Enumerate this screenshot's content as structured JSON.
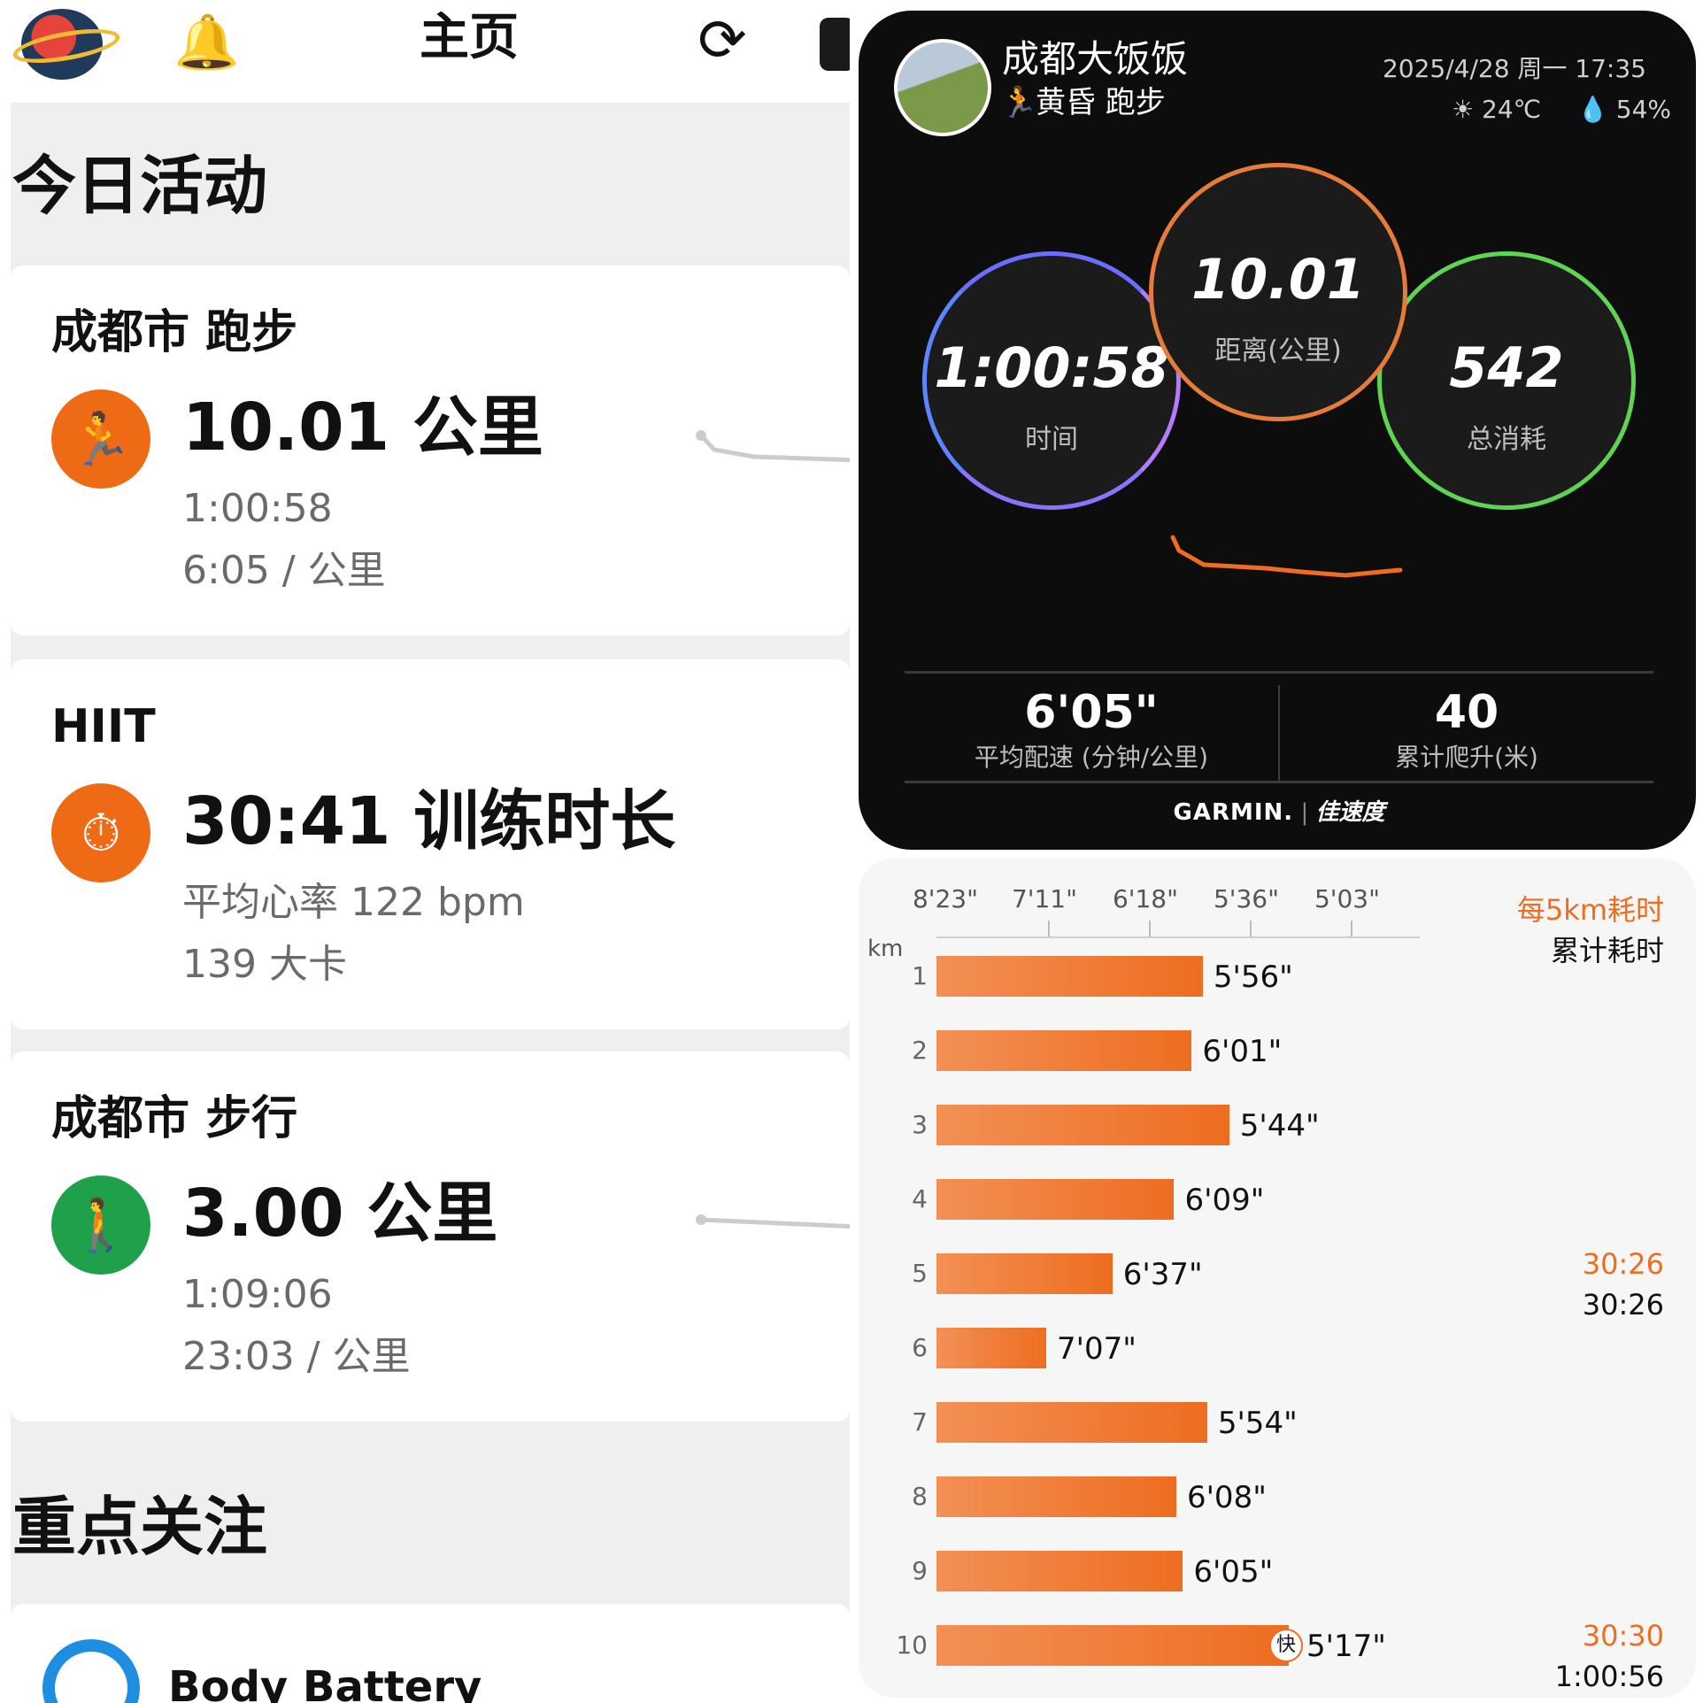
{
  "app": {
    "title": "主页",
    "today_title": "今日活动",
    "focus_title": "重点关注",
    "icons": [
      "planet-icon",
      "bell-icon",
      "sync-icon",
      "watch-icon"
    ]
  },
  "activities": [
    {
      "title": "成都市 跑步",
      "icon": "running-icon",
      "color": "#ee6a14",
      "main": "10.01 公里",
      "line1": "1:00:58",
      "line2": "6:05 / 公里"
    },
    {
      "title": "HIIT",
      "icon": "hiit-icon",
      "color": "#ee6a14",
      "main": "30:41 训练时长",
      "line1": "平均心率 122 bpm",
      "line2": "139 大卡"
    },
    {
      "title": "成都市 步行",
      "icon": "walking-icon",
      "color": "#1fa04a",
      "main": "3.00 公里",
      "line1": "1:09:06",
      "line2": "23:03 / 公里"
    }
  ],
  "body_battery": {
    "title": "Body Battery",
    "icon": "body-battery-icon"
  },
  "garmin_card": {
    "user": "成都大饭饭",
    "activity_label": "黄昏 跑步",
    "datetime": "2025/4/28 周一 17:35",
    "temperature": "24℃",
    "humidity": "54%",
    "time_value": "1:00:58",
    "time_label": "时间",
    "distance_value": "10.01",
    "distance_label": "距离(公里)",
    "calories_value": "542",
    "calories_label": "总消耗",
    "avg_pace_value": "6'05\"",
    "avg_pace_label": "平均配速 (分钟/公里)",
    "elevation_value": "40",
    "elevation_label": "累计爬升(米)",
    "footer_brand": "GARMIN.",
    "footer_app": "佳速度",
    "colors": {
      "time_ring": "#7a6cff",
      "distance_ring": "#e67b3a",
      "calories_ring": "#5fd453"
    }
  },
  "splits": {
    "axis_ticks": [
      "8'23\"",
      "7'11\"",
      "6'18\"",
      "5'36\"",
      "5'03\""
    ],
    "unit": "km",
    "legend_top": "每5km耗时",
    "legend_bottom": "累计耗时",
    "fast_badge": "快",
    "summary": [
      {
        "after_km": 5,
        "split": "30:26",
        "cumulative": "30:26"
      },
      {
        "after_km": 10,
        "split": "30:30",
        "cumulative": "1:00:56"
      }
    ]
  },
  "chart_data": {
    "type": "bar",
    "orientation": "horizontal",
    "categories": [
      "1",
      "2",
      "3",
      "4",
      "5",
      "6",
      "7",
      "8",
      "9",
      "10"
    ],
    "values_label": [
      "5'56\"",
      "6'01\"",
      "5'44\"",
      "6'09\"",
      "6'37\"",
      "7'07\"",
      "5'54\"",
      "6'08\"",
      "6'05\"",
      "5'17\""
    ],
    "values_seconds": [
      356,
      361,
      344,
      369,
      397,
      427,
      354,
      368,
      365,
      317
    ],
    "xlabel": "",
    "ylabel": "km",
    "xtick_labels": [
      "8'23\"",
      "7'11\"",
      "6'18\"",
      "5'36\"",
      "5'03\""
    ],
    "grid": false
  }
}
